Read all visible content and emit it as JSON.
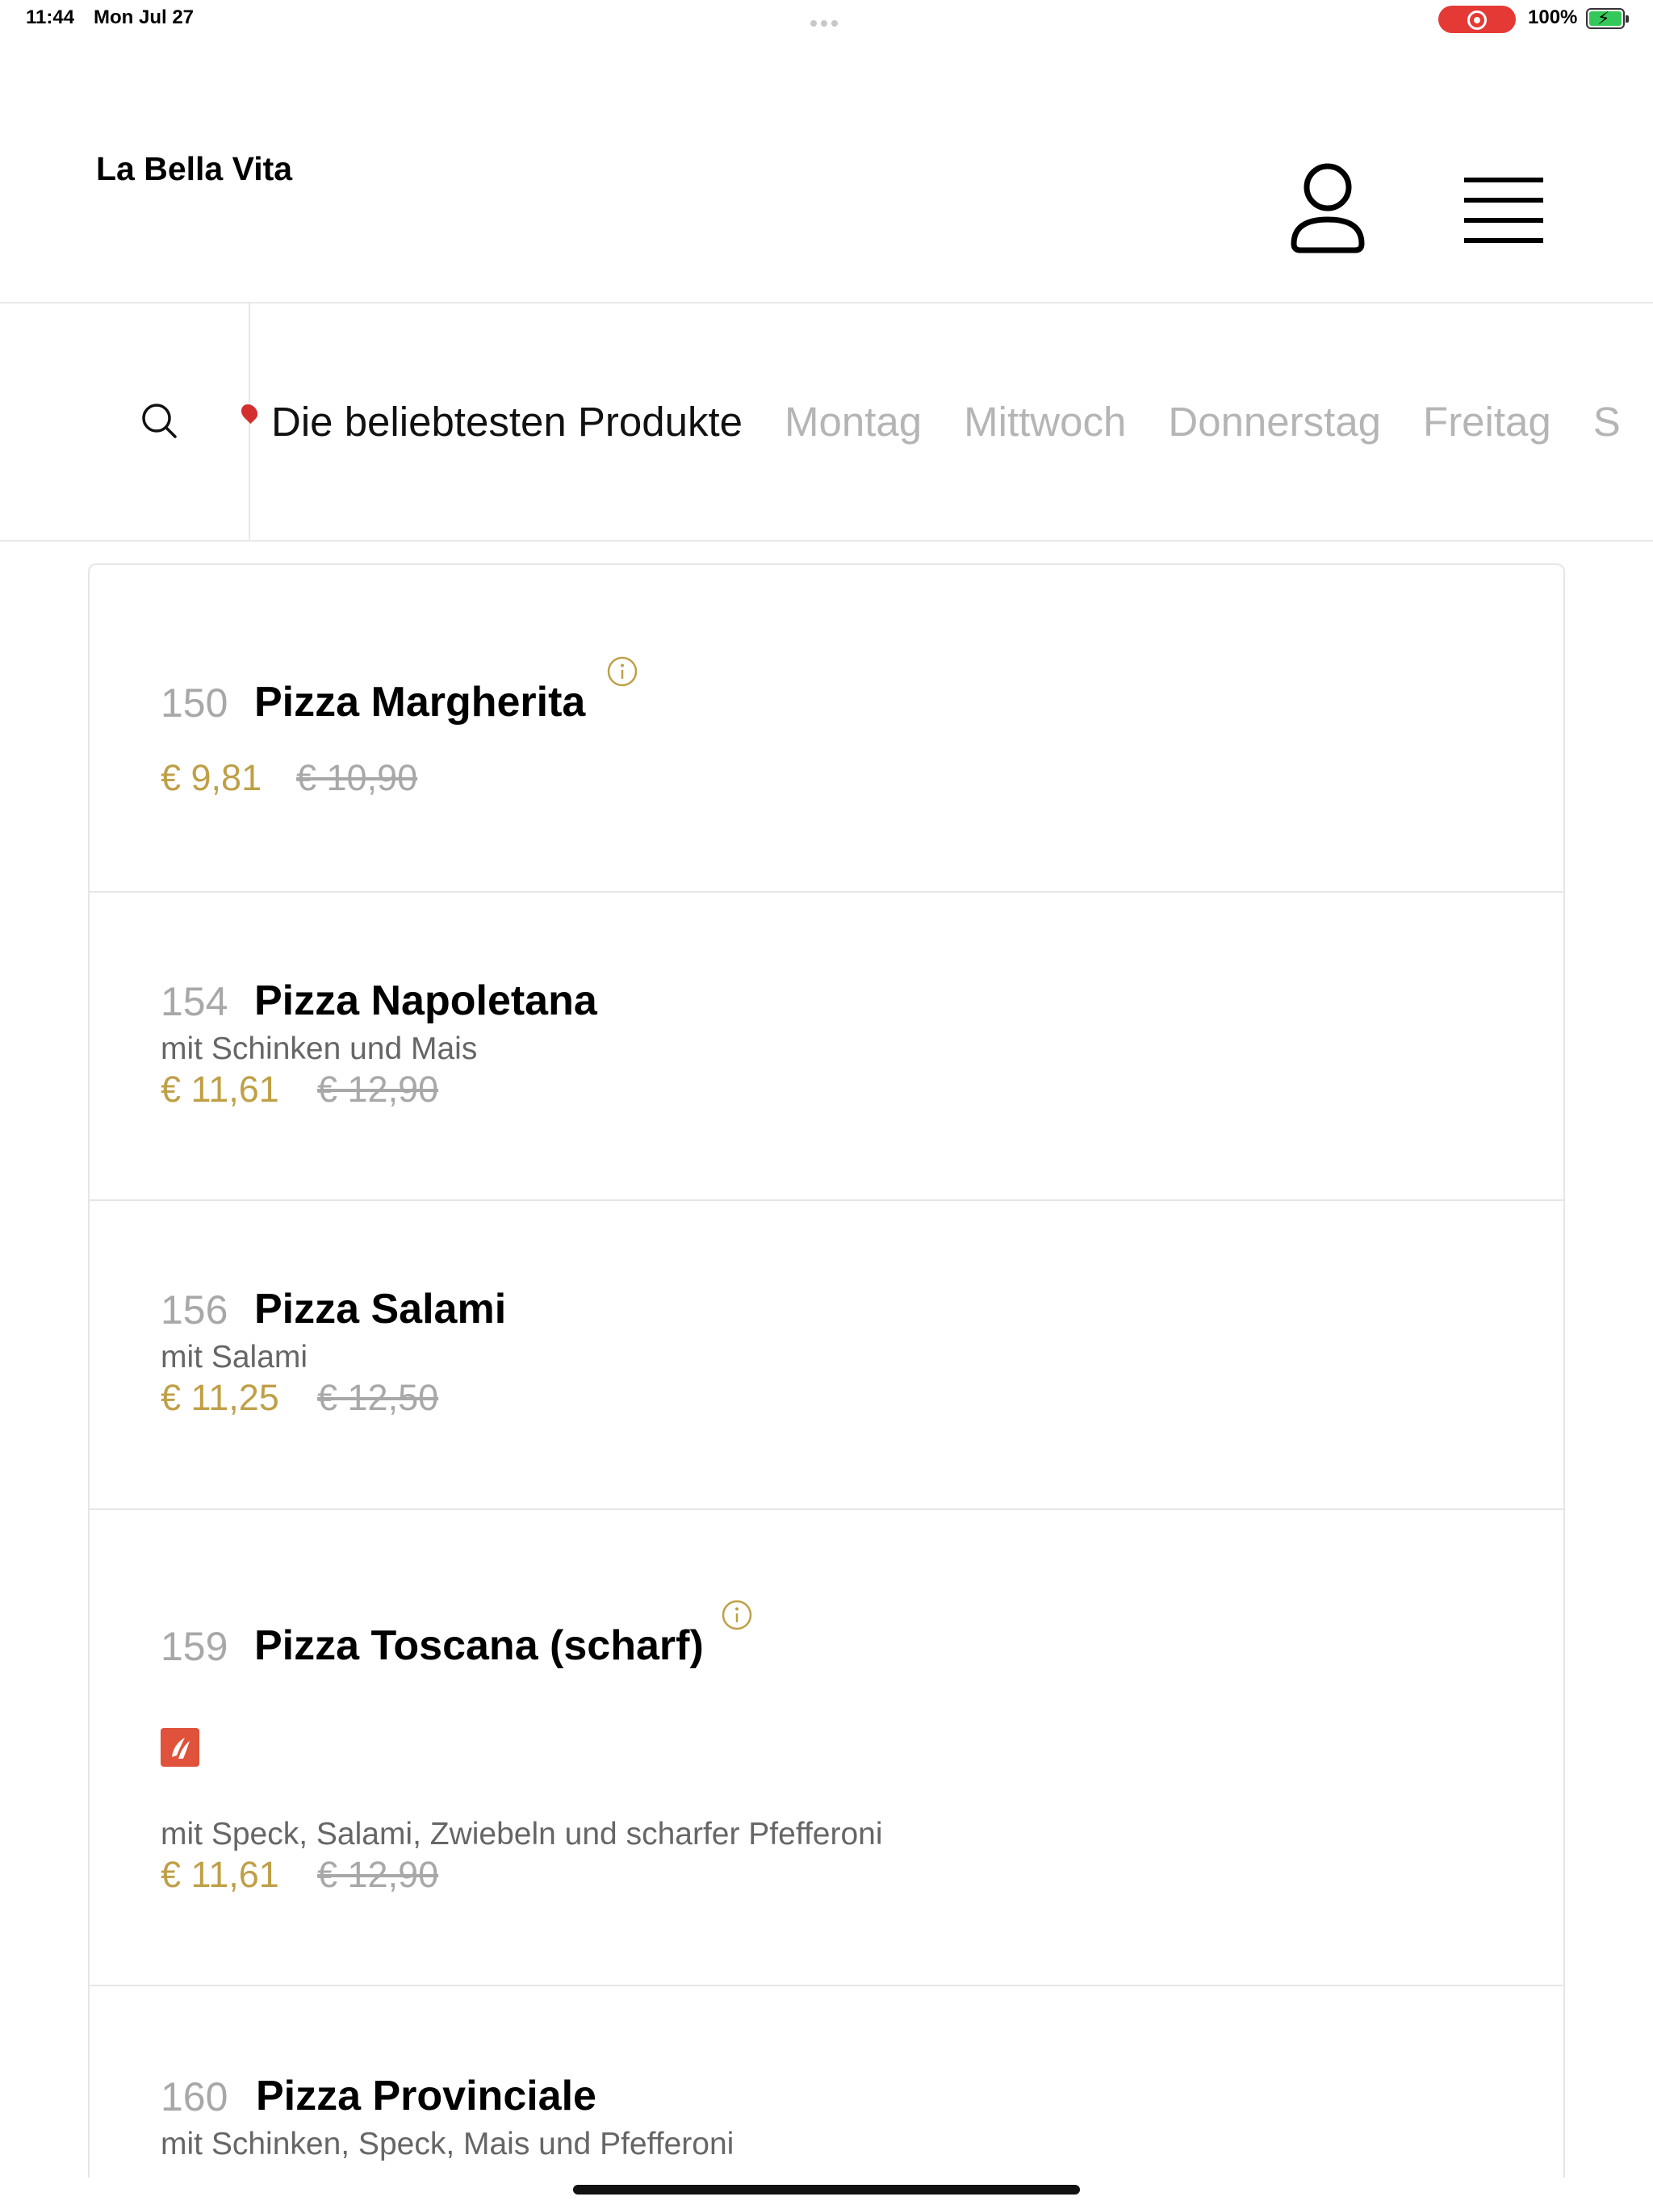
{
  "status_bar": {
    "time": "11:44",
    "date": "Mon Jul 27",
    "battery": "100%"
  },
  "header": {
    "title": "La Bella Vita"
  },
  "categories": [
    {
      "label": "Die beliebtesten Produkte",
      "active": true
    },
    {
      "label": "Montag"
    },
    {
      "label": "Mittwoch"
    },
    {
      "label": "Donnerstag"
    },
    {
      "label": "Freitag"
    },
    {
      "label": "S"
    }
  ],
  "products": [
    {
      "number": "150",
      "name": "Pizza Margherita",
      "description": "",
      "price": "€ 9,81",
      "old_price": "€ 10,90"
    },
    {
      "number": "154",
      "name": "Pizza Napoletana",
      "description": "mit Schinken und Mais",
      "price": "€ 11,61",
      "old_price": "€ 12,90"
    },
    {
      "number": "156",
      "name": "Pizza Salami",
      "description": "mit Salami",
      "price": "€ 11,25",
      "old_price": "€ 12,50"
    },
    {
      "number": "159",
      "name": "Pizza Toscana (scharf)",
      "description": "mit Speck, Salami, Zwiebeln und scharfer Pfefferoni",
      "price": "€ 11,61",
      "old_price": "€ 12,90"
    },
    {
      "number": "160",
      "name": "Pizza Provinciale",
      "description": "mit Schinken, Speck, Mais und Pfefferoni",
      "price": "",
      "old_price": ""
    }
  ],
  "colors": {
    "accent_gold": "#bfa047",
    "spicy": "#e0523b",
    "record": "#e53935"
  }
}
